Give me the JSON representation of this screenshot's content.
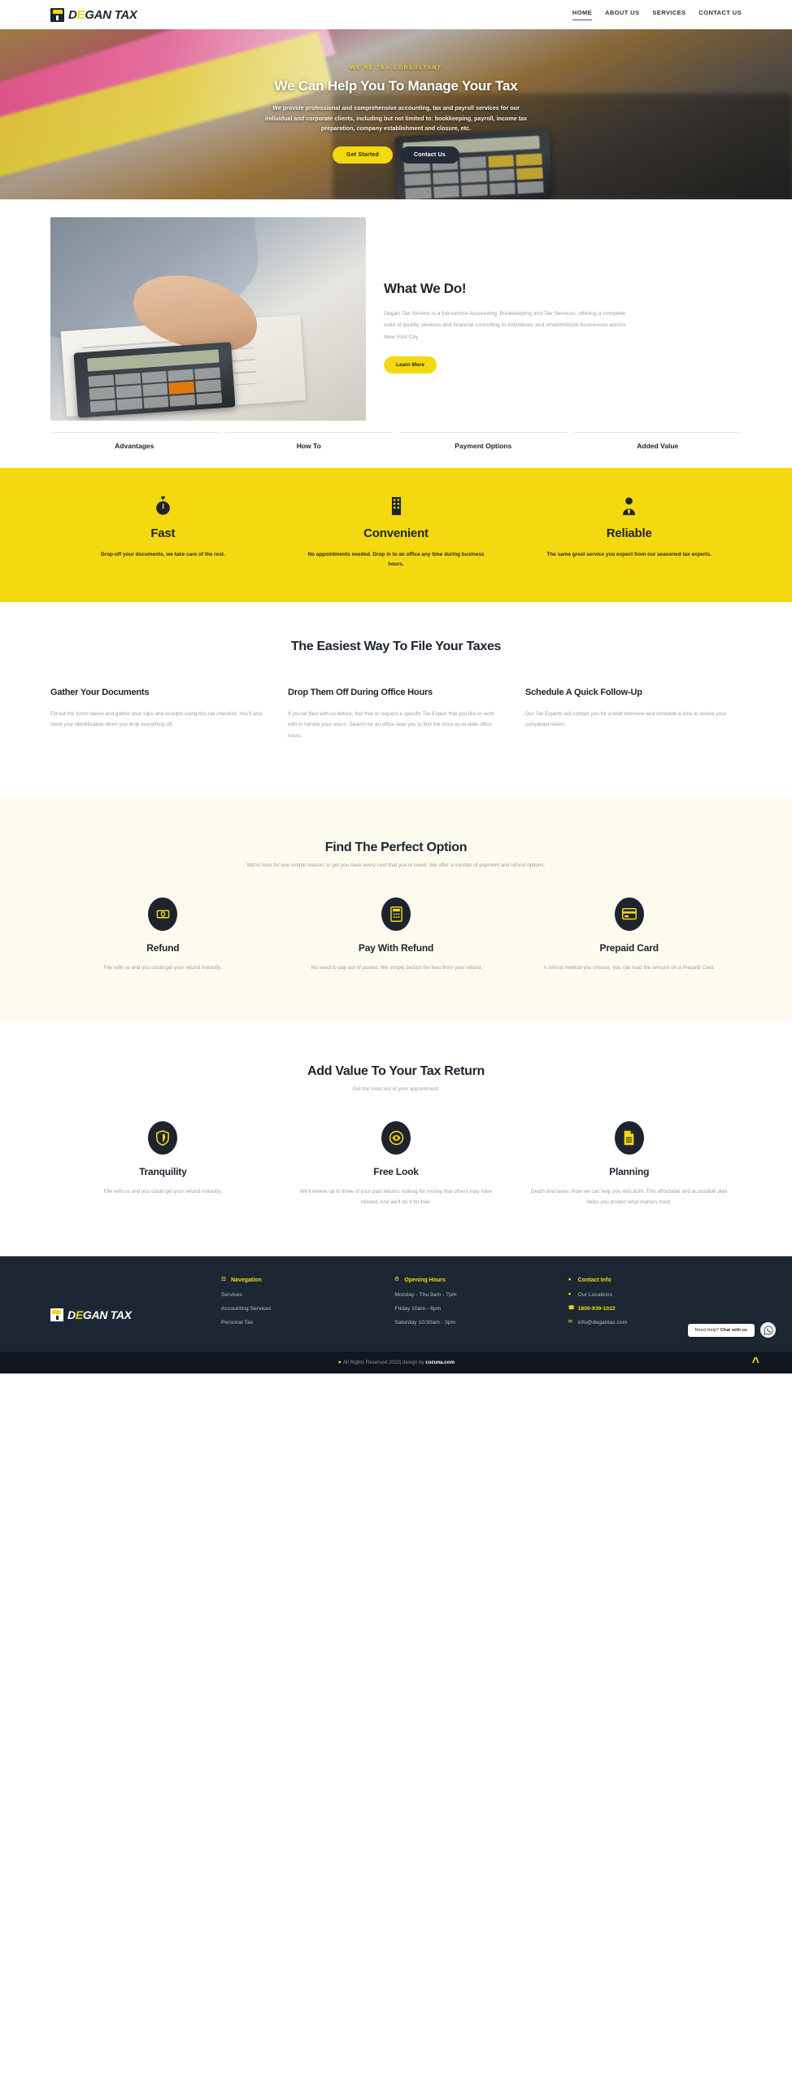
{
  "header": {
    "brand": {
      "part1": "D",
      "accent": "E",
      "part2": "GAN TAX"
    },
    "nav": [
      {
        "label": "HOME",
        "active": true
      },
      {
        "label": "ABOUT US",
        "active": false
      },
      {
        "label": "SERVICES",
        "active": false
      },
      {
        "label": "CONTACT US",
        "active": false
      }
    ]
  },
  "hero": {
    "eyebrow": "WE'RE TAX CONSULTANT",
    "title": "We Can Help You To Manage Your Tax",
    "description": "We provide professional and comprehensive accounting, tax and payroll services for our individual and corporate clients, including but not limited to: bookkeeping, payroll, income tax preparation, company establishment and closure, etc.",
    "primary_button": "Get Started",
    "secondary_button": "Contact Us"
  },
  "what_we_do": {
    "title": "What We Do!",
    "description": "Degan Tax Service is a full-service Accounting, Bookkeeping and Tax Services, offering a complete suite of quality services and financial consulting to individuals and small/midsize businesses across New York City",
    "button": "Learn More"
  },
  "tabs": [
    {
      "label": "Advantages"
    },
    {
      "label": "How To"
    },
    {
      "label": "Payment Options"
    },
    {
      "label": "Added Value"
    }
  ],
  "features": {
    "accent_color": "#f5d910",
    "items": [
      {
        "icon": "stopwatch-icon",
        "title": "Fast",
        "description": "Drop-off your documents, we take care of the rest."
      },
      {
        "icon": "building-icon",
        "title": "Convenient",
        "description": "No appointments needed. Drop in to an office any time during business hours."
      },
      {
        "icon": "person-tie-icon",
        "title": "Reliable",
        "description": "The same great service you expect from our seasoned tax experts."
      }
    ]
  },
  "easiest": {
    "title": "The Easiest Way To File Your Taxes",
    "steps": [
      {
        "title": "Gather Your Documents",
        "description": "Fill out the forms below and gather your slips and receipts using this tax checklist. You'll also need your identification when you drop everything off."
      },
      {
        "title": "Drop Them Off During Office Hours",
        "description": "If you've filed with us before, feel free to request a specific Tax Expert that you like to work with to handle your return. Search for an office near you to find the most up-to-date office hours."
      },
      {
        "title": "Schedule A Quick Follow-Up",
        "description": "Our Tax Experts will contact you for a brief interview and schedule a time to review your completed return."
      }
    ]
  },
  "perfect_option": {
    "title": "Find The Perfect Option",
    "subtitle": "We're here for one simple reason: to get you back every cent that you're owed. We offer a number of payment and refund options.",
    "items": [
      {
        "icon": "money-icon",
        "title": "Refund",
        "description": "File with us and you could get your refund instantly."
      },
      {
        "icon": "calculator-icon",
        "title": "Pay With Refund",
        "description": "No need to pay out of pocket. We simply deduct the fees from your refund"
      },
      {
        "icon": "credit-card-icon",
        "title": "Prepaid Card",
        "description": "A refund method you choose, you can load the amount on a Prepaid Card."
      }
    ]
  },
  "add_value": {
    "title": "Add Value To Your Tax Return",
    "subtitle": "Get the most out of your appointment.",
    "items": [
      {
        "icon": "shield-icon",
        "title": "Tranquility",
        "description": "File with us and you could get your refund instantly."
      },
      {
        "icon": "eye-icon",
        "title": "Free Look",
        "description": "We'll review up to three of your past returns looking for money that others may have missed. And we'll do it for free."
      },
      {
        "icon": "document-icon",
        "title": "Planning",
        "description": "Death and taxes. Now we can help you with both. This affordable and accessible plan helps you protect what matters most."
      }
    ]
  },
  "footer": {
    "brand": {
      "part1": "D",
      "accent": "E",
      "part2": "GAN TAX"
    },
    "columns": [
      {
        "icon": "nav-icon",
        "heading": "Navegation",
        "items": [
          {
            "icon": "",
            "label": "Services",
            "strong": false
          },
          {
            "icon": "",
            "label": "Accounting Services",
            "strong": false
          },
          {
            "icon": "",
            "label": "Personal Tax",
            "strong": false
          }
        ]
      },
      {
        "icon": "clock-icon",
        "heading": "Opening Hours",
        "items": [
          {
            "icon": "",
            "label": "Monday - Thu 9am - 7pm",
            "strong": false
          },
          {
            "icon": "",
            "label": "Friday 10am - 6pm",
            "strong": false
          },
          {
            "icon": "",
            "label": "Saturday 10:30am - 3pm",
            "strong": false
          }
        ]
      },
      {
        "icon": "location-pin-icon",
        "heading": "Contact Info",
        "items": [
          {
            "icon": "location-pin-icon",
            "label": "Our Locations",
            "strong": false
          },
          {
            "icon": "phone-icon",
            "label": "1800-939-1022",
            "strong": true
          },
          {
            "icon": "envelope-icon",
            "label": "info@degantax.com",
            "strong": false
          }
        ]
      }
    ],
    "bottom": {
      "star": "★",
      "prefix": "All Rights Reserved 2022| design by ",
      "brand": "cozuna.com"
    }
  },
  "chat_widget": {
    "bubble_prefix": "Need Help? ",
    "bubble_strong": "Chat with us",
    "icon": "whatsapp-icon"
  }
}
